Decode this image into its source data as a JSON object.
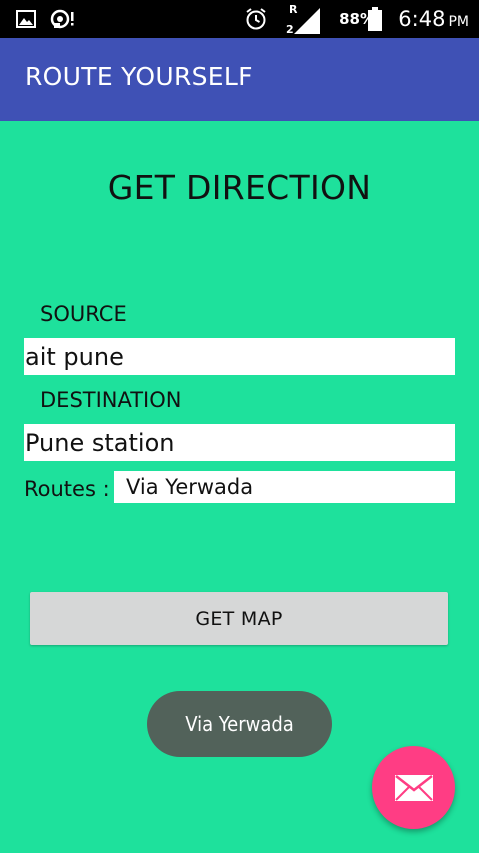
{
  "status_bar": {
    "battery_percent": "88%",
    "time": "6:48",
    "ampm": "PM",
    "network_indicator": "R",
    "icons": [
      "image-icon",
      "media-icon",
      "alarm-icon",
      "signal-icon",
      "battery-icon"
    ]
  },
  "app_bar": {
    "title": "ROUTE YOURSELF",
    "color": "#3f51b5"
  },
  "main": {
    "heading": "GET DIRECTION",
    "background": "#1ee19c",
    "source": {
      "label": "SOURCE",
      "value": "ait pune"
    },
    "destination": {
      "label": "DESTINATION",
      "value": "Pune station"
    },
    "routes": {
      "label": "Routes :",
      "selected": "Via Yerwada"
    },
    "get_map_button": "GET MAP"
  },
  "toast": {
    "text": "Via Yerwada"
  },
  "fab": {
    "icon": "mail-icon",
    "color": "#ff3d84"
  }
}
